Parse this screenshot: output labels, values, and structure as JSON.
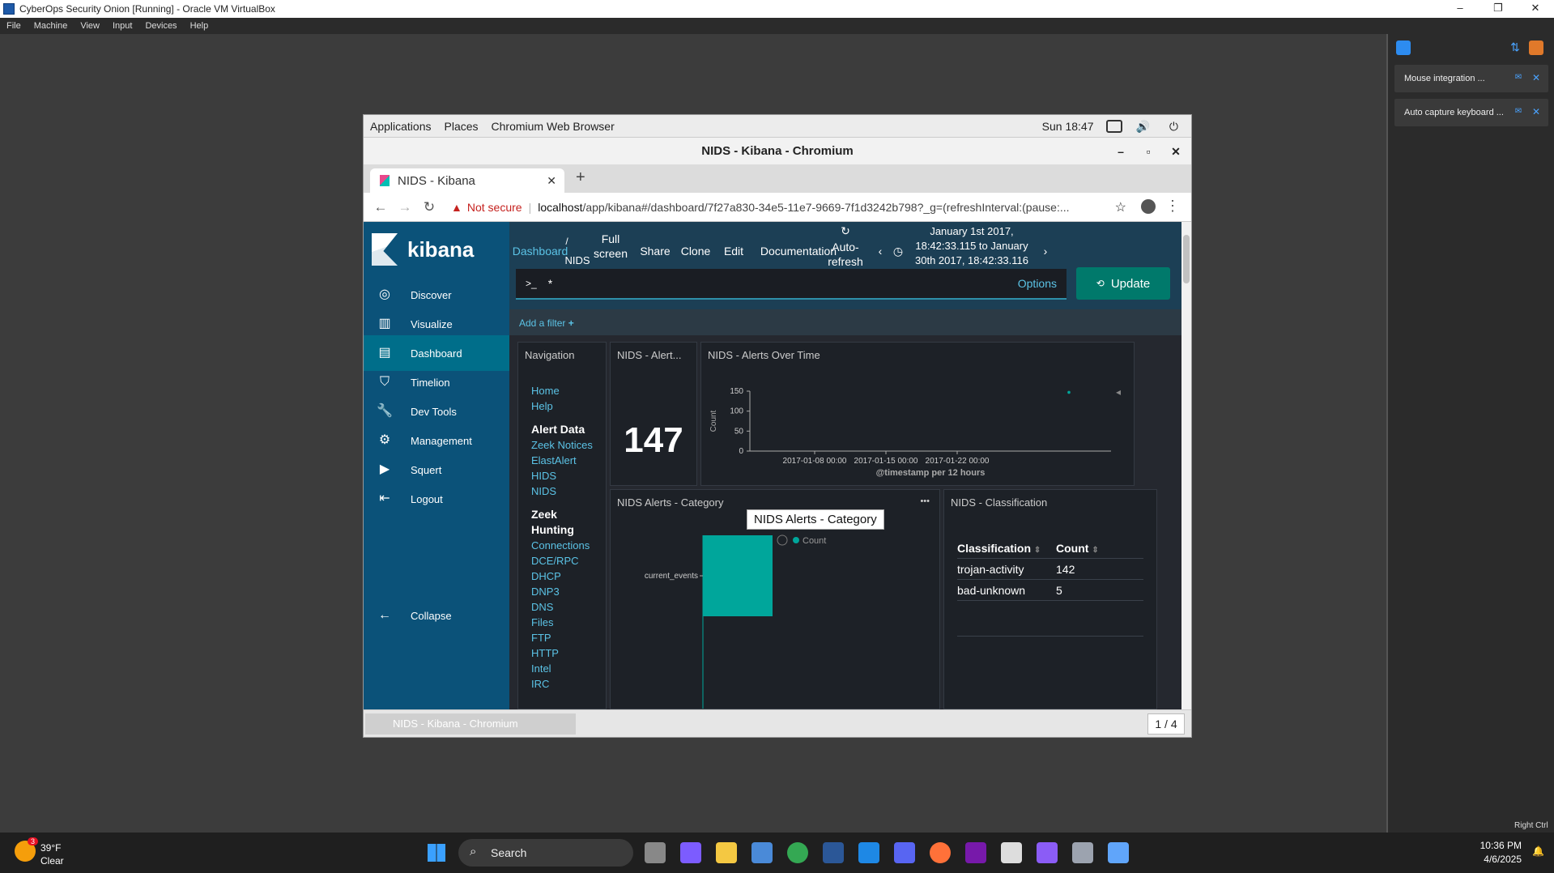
{
  "vbox": {
    "title": "CyberOps Security Onion [Running] - Oracle VM VirtualBox",
    "menu": [
      "File",
      "Machine",
      "View",
      "Input",
      "Devices",
      "Help"
    ],
    "notifications": [
      "Mouse integration ...",
      "Auto capture keyboard ..."
    ],
    "host_key": "Right Ctrl"
  },
  "gnome": {
    "menus": [
      "Applications",
      "Places",
      "Chromium Web Browser"
    ],
    "clock": "Sun 18:47"
  },
  "chrome": {
    "window_title": "NIDS - Kibana - Chromium",
    "tab_title": "NIDS - Kibana",
    "security": "Not secure",
    "url_host": "localhost",
    "url_rest": "/app/kibana#/dashboard/7f27a830-34e5-11e7-9669-7f1d3242b798?_g=(refreshInterval:(pause:...",
    "bottom_tab": "NIDS - Kibana - Chromium",
    "page_count": "1 / 4"
  },
  "kibana": {
    "brand": "kibana",
    "nav": [
      "Discover",
      "Visualize",
      "Dashboard",
      "Timelion",
      "Dev Tools",
      "Management",
      "Squert",
      "Logout"
    ],
    "active_nav": "Dashboard",
    "collapse": "Collapse",
    "top": {
      "breadcrumb_link": "Dashboard",
      "breadcrumb_sep": "/",
      "breadcrumb_current": "NIDS",
      "full_screen": "Full\nscreen",
      "share": "Share",
      "clone": "Clone",
      "edit": "Edit",
      "documentation": "Documentation",
      "auto_refresh": "Auto-\nrefresh",
      "time_range": "January 1st 2017, 18:42:33.115 to January 30th 2017, 18:42:33.116"
    },
    "query": {
      "prompt": ">_",
      "value": "*",
      "options": "Options",
      "update": "Update"
    },
    "add_filter": "Add a filter"
  },
  "panels": {
    "navigation": {
      "title": "Navigation",
      "links_top": [
        "Home",
        "Help"
      ],
      "alert_data_header": "Alert Data",
      "alert_links": [
        "Zeek Notices",
        "ElastAlert",
        "HIDS",
        "NIDS"
      ],
      "zeek_header": "Zeek Hunting",
      "zeek_links": [
        "Connections",
        "DCE/RPC",
        "DHCP",
        "DNP3",
        "DNS",
        "Files",
        "FTP",
        "HTTP",
        "Intel",
        "IRC"
      ]
    },
    "alert_count": {
      "title": "NIDS - Alert...",
      "value": "147"
    },
    "alerts_over_time": {
      "title": "NIDS - Alerts Over Time",
      "ylabel": "Count",
      "xlabel": "@timestamp per 12 hours",
      "yticks": [
        "150",
        "100",
        "50",
        "0"
      ],
      "xticks": [
        "2017-01-08 00:00",
        "2017-01-15 00:00",
        "2017-01-22 00:00"
      ]
    },
    "category": {
      "title": "NIDS Alerts - Category",
      "tooltip": "NIDS Alerts - Category",
      "legend": "Count",
      "bar_label": "current_events",
      "more": "•••"
    },
    "classification": {
      "title": "NIDS - Classification",
      "headers": [
        "Classification",
        "Count"
      ],
      "rows": [
        [
          "trojan-activity",
          "142"
        ],
        [
          "bad-unknown",
          "5"
        ]
      ]
    }
  },
  "chart_data": [
    {
      "type": "scatter",
      "title": "NIDS - Alerts Over Time",
      "xlabel": "@timestamp per 12 hours",
      "ylabel": "Count",
      "x": [
        "2017-01-28 00:00"
      ],
      "y": [
        147
      ],
      "ylim": [
        0,
        150
      ]
    },
    {
      "type": "bar",
      "title": "NIDS Alerts - Category",
      "categories": [
        "current_events"
      ],
      "series": [
        {
          "name": "Count",
          "values": [
            147
          ]
        }
      ]
    }
  ],
  "taskbar": {
    "weather_temp": "39°F",
    "weather_desc": "Clear",
    "weather_badge": "3",
    "search": "Search",
    "time": "10:36 PM",
    "date": "4/6/2025"
  }
}
